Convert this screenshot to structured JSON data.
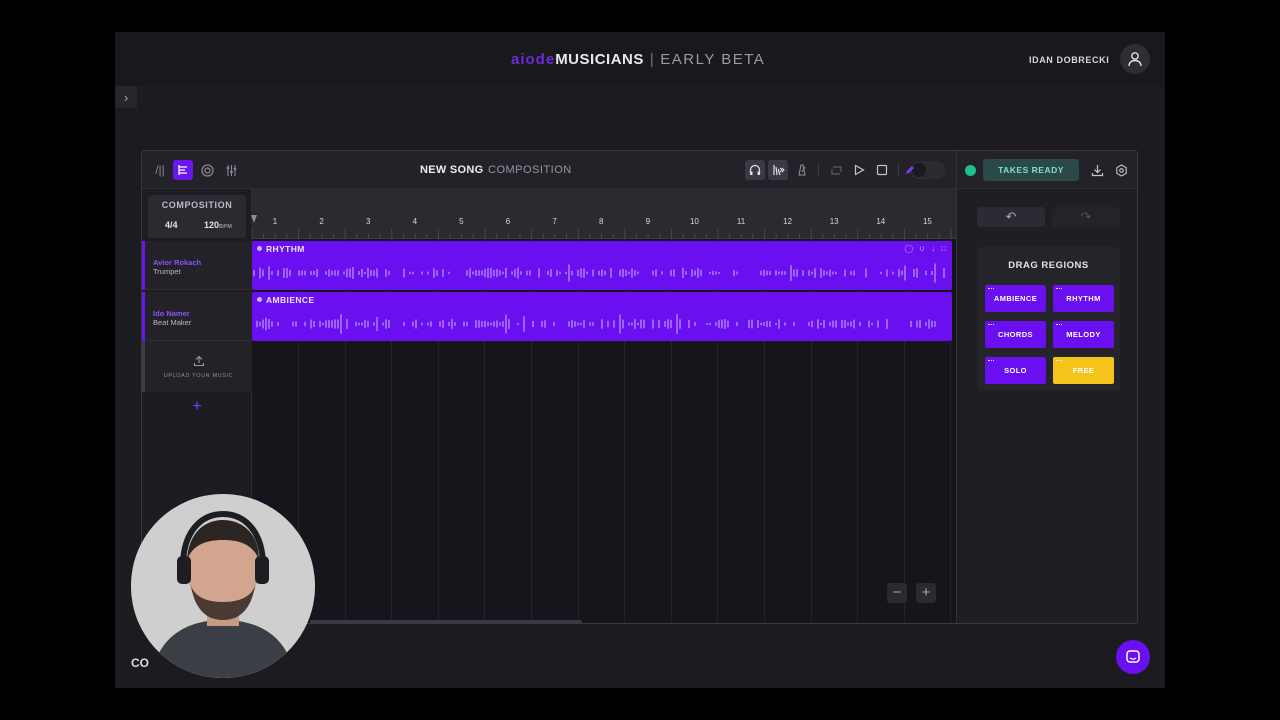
{
  "header": {
    "brand_part1": "aiode",
    "brand_part2": "MUSICIANS",
    "brand_sep": "|",
    "brand_part3": "EARLY BETA",
    "user_name": "IDAN DOBRECKI"
  },
  "toolbar": {
    "song_title": "NEW SONG",
    "mode": "COMPOSITION"
  },
  "composition": {
    "label": "COMPOSITION",
    "time_signature": "4/4",
    "bpm": "120",
    "bpm_unit": "BPM"
  },
  "tracks": [
    {
      "name": "Avior Rokach",
      "role": "Trumpet",
      "clip_title": "RHYTHM"
    },
    {
      "name": "Ido Namer",
      "role": "Beat Maker",
      "clip_title": "AMBIENCE"
    }
  ],
  "upload": {
    "label": "UPLOAD YOUR MUSIC"
  },
  "ruler": {
    "bars": [
      "1",
      "2",
      "3",
      "4",
      "5",
      "6",
      "7",
      "8",
      "9",
      "10",
      "11",
      "12",
      "13",
      "14",
      "15"
    ]
  },
  "right_panel": {
    "takes_label": "TAKES READY",
    "regions_title": "DRAG REGIONS",
    "regions": [
      "AMBIENCE",
      "RHYTHM",
      "CHORDS",
      "MELODY",
      "SOLO",
      "FREE"
    ]
  },
  "overlay": {
    "cc_label": "CO"
  },
  "colors": {
    "accent": "#6a0ff0",
    "free": "#f5c41a",
    "status": "#1fc08f"
  }
}
